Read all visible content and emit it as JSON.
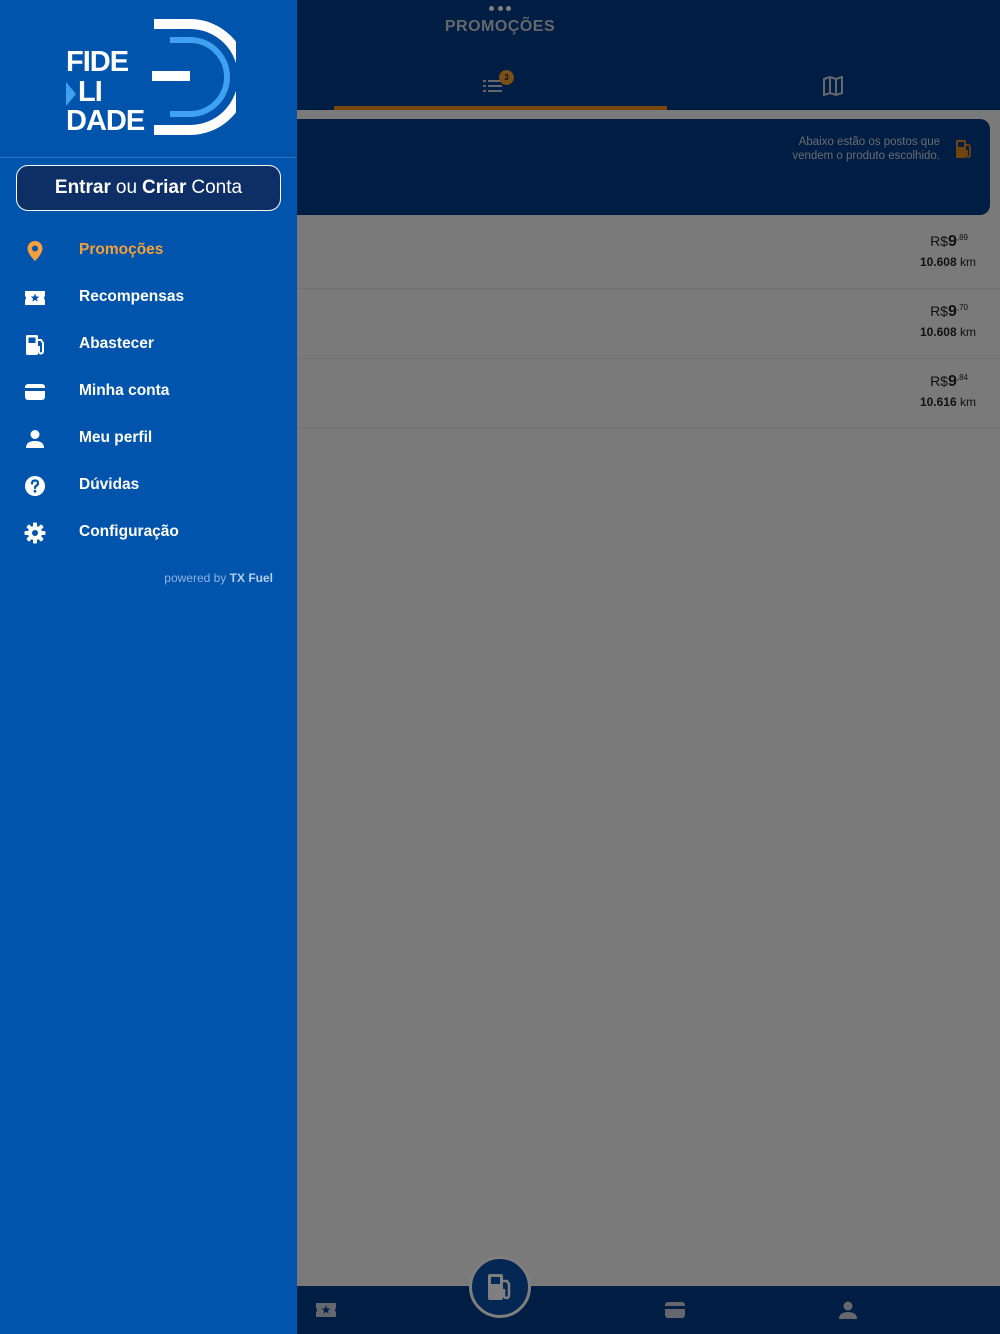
{
  "header": {
    "title": "PROMOÇÕES",
    "list_badge": "3"
  },
  "info_card": {
    "text_line1": "Abaixo estão os postos que",
    "text_line2": "vendem o produto escolhido."
  },
  "stations": [
    {
      "currency": "R$",
      "price_int": "9",
      "price_dec": ",89",
      "distance": "10.608",
      "unit": "km"
    },
    {
      "currency": "R$",
      "price_int": "9",
      "price_dec": ",70",
      "distance": "10.608",
      "unit": "km"
    },
    {
      "currency": "R$",
      "price_int": "9",
      "price_dec": ",84",
      "distance": "10.616",
      "unit": "km"
    }
  ],
  "drawer": {
    "logo": {
      "line1": "FIDE",
      "line2": "LI",
      "line3": "DADE",
      "mark": "3"
    },
    "login": {
      "part1": "Entrar",
      "part2": "ou",
      "part3": "Criar",
      "part4": "Conta"
    },
    "menu": [
      {
        "label": "Promoções",
        "icon": "map-pin-icon",
        "active": true
      },
      {
        "label": "Recompensas",
        "icon": "ticket-star-icon",
        "active": false
      },
      {
        "label": "Abastecer",
        "icon": "fuel-pump-icon",
        "active": false
      },
      {
        "label": "Minha conta",
        "icon": "wallet-card-icon",
        "active": false
      },
      {
        "label": "Meu perfil",
        "icon": "user-icon",
        "active": false
      },
      {
        "label": "Dúvidas",
        "icon": "help-circle-icon",
        "active": false
      },
      {
        "label": "Configuração",
        "icon": "gear-icon",
        "active": false
      }
    ],
    "powered_prefix": "powered by",
    "powered_brand": "TX Fuel"
  },
  "colors": {
    "primary": "#0054ac",
    "navy": "#003a86",
    "accent": "#f5a03a"
  }
}
